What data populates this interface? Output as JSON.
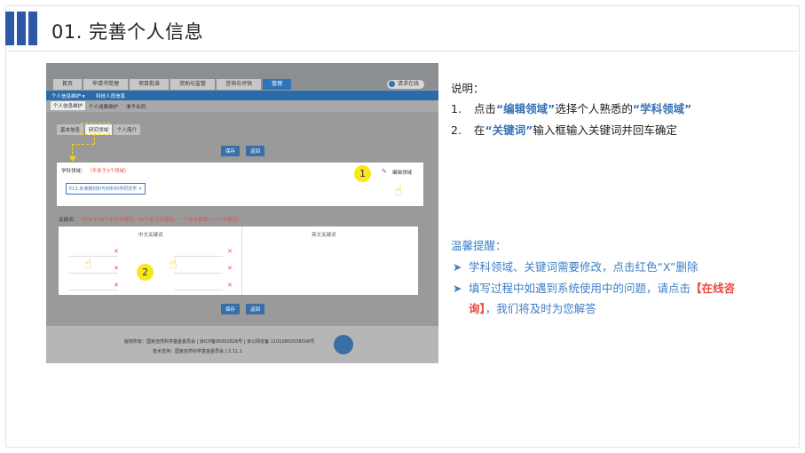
{
  "slide": {
    "title": "01. 完善个人信息"
  },
  "screenshot": {
    "nav_tabs": [
      "首页",
      "申请书受理",
      "项目批准",
      "资助与监管",
      "咨询与评估",
      "管理"
    ],
    "online_button": "请求在线",
    "sub_bar": [
      "个人信息维护 ▾",
      "科技人员信息"
    ],
    "sub_nav": [
      "个人信息维护",
      "个人成果维护",
      "准予合同"
    ],
    "inner_tabs": [
      "基本信息",
      "研究领域",
      "个人简介"
    ],
    "buttons": {
      "save": "保存",
      "return": "返回"
    },
    "field_label": "学科领域：",
    "field_hint": "（不多于3个领域）",
    "tag_text": "E13.京津冀材料与材料科学研究学",
    "edit_domain": "编辑领域",
    "keyword_label": "关键词：",
    "keyword_hint": "（不多于20个中文关键词，20个英文关键词，一个文本框输入一个关键词）",
    "col_cn": "中文关键词",
    "col_en": "英文关键词",
    "marker_1": "1",
    "marker_2": "2",
    "footer_line1": "版权所有：国家自然科学基金委员会 | 京ICP备05002826号 | 京公网安备 11010802038508号",
    "footer_line2": "技术支持：国家自然科学基金委员会 | 2.11.1"
  },
  "right": {
    "heading": "说明：",
    "item1_num": "1.",
    "item1_a": "点击",
    "item1_hl1": "“编辑领域”",
    "item1_b": "选择个人熟悉的",
    "item1_hl2": "“学科领域”",
    "item2_num": "2.",
    "item2_a": "在",
    "item2_hl": "“关键词”",
    "item2_b": "输入框输入关键词并回车确定",
    "tip_title": "温馨提醒：",
    "tip1": "学科领域、关键词需要修改，点击红色“X”删除",
    "tip2_a": "填写过程中如遇到系统使用中的问题，请点击",
    "tip2_hl": "【在线咨",
    "tip2_hl2": "询】",
    "tip2_b": "，我们将及时为您解答"
  },
  "colors": {
    "accent": "#2d57a7",
    "highlight": "#3673b6",
    "marker": "#f7e71c",
    "delete": "#e84c3d"
  }
}
